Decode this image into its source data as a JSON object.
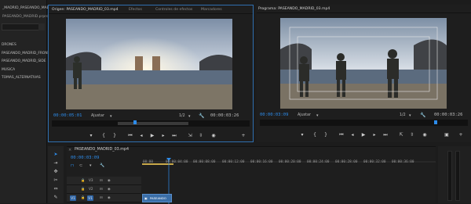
{
  "project": {
    "title": "_MADRID_PASEANDO_MADRID",
    "file": "PASEANDO_MADRID.prproj",
    "bins": [
      "DRONES",
      "PASEANDO_MADRID_FRONT",
      "PASEANDO_MADRID_SIDE",
      "MUSICA",
      "TOMAS_ALTERNATIVAS"
    ]
  },
  "source": {
    "tabs": [
      "Origen: PASEANDO_MADRID_03.mp4",
      "Efectos",
      "Controles de efectos",
      "Marcadores"
    ],
    "timecode_in": "00:00:05:01",
    "fit_label": "Ajustar",
    "resolution": "1/2",
    "duration": "00:00:03:26"
  },
  "program": {
    "tab": "Programa: PASEANDO_MADRID_03.mp4",
    "timecode": "00:00:03:09",
    "fit_label": "Ajustar",
    "resolution": "1/2",
    "duration": "00:00:03:26"
  },
  "timeline": {
    "tab": "PASEANDO_MADRID_03.mp4",
    "timecode": "00:00:03:09",
    "ruler": [
      "00:00",
      "00:00:04:00",
      "00:00:08:00",
      "00:00:12:00",
      "00:00:16:00",
      "00:00:20:00",
      "00:00:24:00",
      "00:00:28:00",
      "00:00:32:00",
      "00:00:36:00"
    ],
    "tracks": [
      "V3",
      "V2",
      "V1"
    ],
    "clip_label": "PASEANDO"
  },
  "colors": {
    "accent": "#2d8ceb",
    "panel_border": "#2f6fb0",
    "clip": "#3a6ea8"
  },
  "icons": {
    "transport": [
      "marker-icon",
      "mark-in-icon",
      "mark-out-icon",
      "go-to-in-icon",
      "step-back-icon",
      "play-icon",
      "step-forward-icon",
      "go-to-out-icon",
      "insert-icon",
      "overwrite-icon",
      "export-frame-icon",
      "add-icon"
    ]
  }
}
